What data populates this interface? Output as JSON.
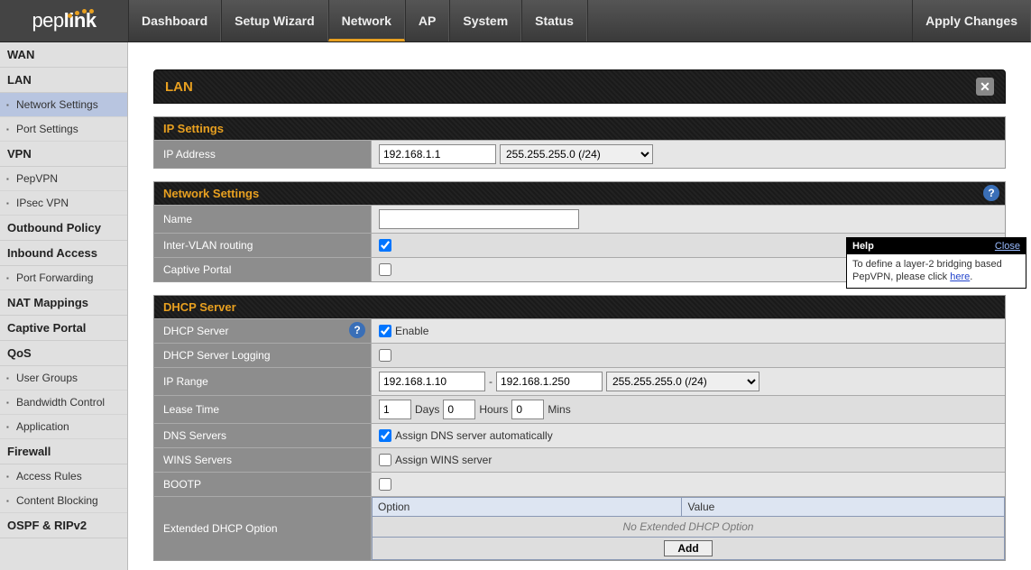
{
  "brand": "peplink",
  "topnav": {
    "items": [
      "Dashboard",
      "Setup Wizard",
      "Network",
      "AP",
      "System",
      "Status"
    ],
    "active_index": 2,
    "apply": "Apply Changes"
  },
  "sidebar": {
    "groups": [
      {
        "title": "WAN",
        "items": []
      },
      {
        "title": "LAN",
        "items": [
          "Network Settings",
          "Port Settings"
        ],
        "selected_index": 0
      },
      {
        "title": "VPN",
        "items": [
          "PepVPN",
          "IPsec VPN"
        ]
      },
      {
        "title": "Outbound Policy",
        "items": []
      },
      {
        "title": "Inbound Access",
        "items": [
          "Port Forwarding"
        ]
      },
      {
        "title": "NAT Mappings",
        "items": []
      },
      {
        "title": "Captive Portal",
        "items": []
      },
      {
        "title": "QoS",
        "items": [
          "User Groups",
          "Bandwidth Control",
          "Application"
        ]
      },
      {
        "title": "Firewall",
        "items": [
          "Access Rules",
          "Content Blocking"
        ]
      },
      {
        "title": "OSPF & RIPv2",
        "items": []
      }
    ]
  },
  "page": {
    "title": "LAN",
    "ip_settings": {
      "header": "IP Settings",
      "ip_label": "IP Address",
      "ip_value": "192.168.1.1",
      "mask_value": "255.255.255.0 (/24)"
    },
    "net_settings": {
      "header": "Network Settings",
      "name_label": "Name",
      "name_value": "",
      "ivr_label": "Inter-VLAN routing",
      "ivr_checked": true,
      "cp_label": "Captive Portal",
      "cp_checked": false
    },
    "dhcp": {
      "header": "DHCP Server",
      "server_label": "DHCP Server",
      "server_enable_label": "Enable",
      "server_checked": true,
      "log_label": "DHCP Server Logging",
      "log_checked": false,
      "range_label": "IP Range",
      "range_start": "192.168.1.10",
      "range_dash": "-",
      "range_end": "192.168.1.250",
      "range_mask": "255.255.255.0 (/24)",
      "lease_label": "Lease Time",
      "lease_days": "1",
      "lease_days_u": "Days",
      "lease_hours": "0",
      "lease_hours_u": "Hours",
      "lease_mins": "0",
      "lease_mins_u": "Mins",
      "dns_label": "DNS Servers",
      "dns_auto_label": "Assign DNS server automatically",
      "dns_checked": true,
      "wins_label": "WINS Servers",
      "wins_assign_label": "Assign WINS server",
      "wins_checked": false,
      "bootp_label": "BOOTP",
      "bootp_checked": false,
      "ext_label": "Extended DHCP Option",
      "ext_col_option": "Option",
      "ext_col_value": "Value",
      "ext_empty": "No Extended DHCP Option",
      "ext_add": "Add"
    }
  },
  "tooltip": {
    "title": "Help",
    "close": "Close",
    "text_before": "To define a layer-2 bridging based PepVPN, please click ",
    "link": "here",
    "text_after": "."
  }
}
